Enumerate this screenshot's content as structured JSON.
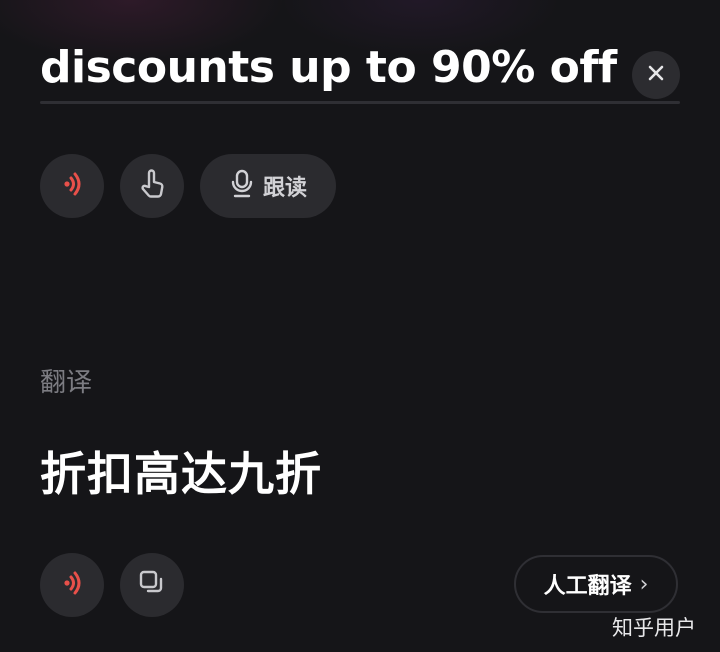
{
  "source": {
    "text": "discounts up to 90% off"
  },
  "actions": {
    "follow_read_label": "跟读"
  },
  "translation_section": {
    "label": "翻译",
    "text": "折扣高达九折"
  },
  "footer": {
    "human_translation_label": "人工翻译",
    "chevron": "›"
  },
  "watermark": "知乎用户",
  "icons": {
    "clear": "close-icon",
    "speaker": "speaker-icon",
    "tap": "hand-pointer-icon",
    "mic": "microphone-icon",
    "copy": "copy-icon"
  },
  "colors": {
    "background": "#151518",
    "button_bg": "#2b2b2f",
    "speaker_accent": "#e8504a",
    "label_gray": "#7c7c82"
  }
}
